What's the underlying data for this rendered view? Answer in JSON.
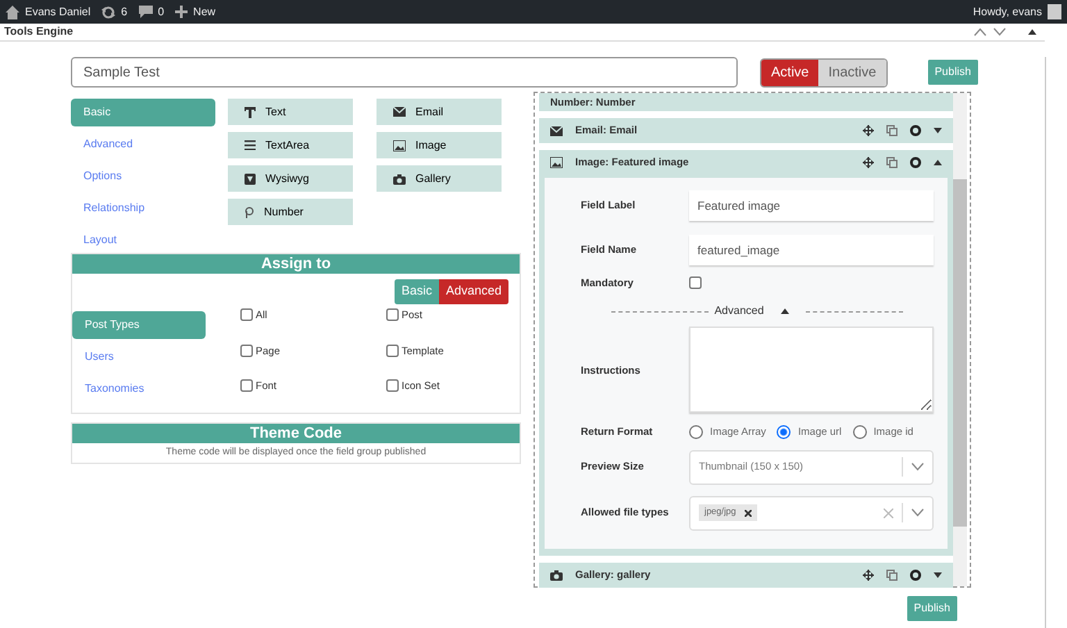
{
  "admin_bar": {
    "items": [
      {
        "label": "Evans Daniel"
      },
      {
        "label": "6"
      },
      {
        "label": "0"
      },
      {
        "label": "New"
      }
    ],
    "greeting": "Howdy, evans"
  },
  "page_title": "Tools Engine",
  "group_title": {
    "value": "Sample Test"
  },
  "status_toggle": [
    {
      "label": "Active",
      "selected": true
    },
    {
      "label": "Inactive",
      "selected": false
    }
  ],
  "top_publish": "Publish",
  "sidebar_tabs": [
    {
      "label": "Basic",
      "selected": true
    },
    {
      "label": "Advanced",
      "selected": false
    },
    {
      "label": "Options",
      "selected": false
    },
    {
      "label": "Relationship",
      "selected": false
    },
    {
      "label": "Layout",
      "selected": false
    }
  ],
  "field_types": [
    {
      "label": "Text"
    },
    {
      "label": "TextArea"
    },
    {
      "label": "Wysiwyg"
    },
    {
      "label": "Number"
    },
    {
      "label": "Email"
    },
    {
      "label": "Image"
    },
    {
      "label": "Gallery"
    }
  ],
  "assign_to": {
    "title": "Assign to",
    "mode_toggle": [
      {
        "label": "Basic",
        "selected": false
      },
      {
        "label": "Advanced",
        "selected": true
      }
    ],
    "tabs": [
      {
        "label": "Post Types",
        "selected": true
      },
      {
        "label": "Users",
        "selected": false
      },
      {
        "label": "Taxonomies",
        "selected": false
      }
    ],
    "options": [
      {
        "label": "All",
        "checked": false
      },
      {
        "label": "Post",
        "checked": false
      },
      {
        "label": "Page",
        "checked": false
      },
      {
        "label": "Template",
        "checked": false
      },
      {
        "label": "Font",
        "checked": false
      },
      {
        "label": "Icon Set",
        "checked": false
      }
    ]
  },
  "theme_code": {
    "title": "Theme Code",
    "message": "Theme code will be displayed once the field group published"
  },
  "fields": [
    {
      "label": "Number: Number",
      "expanded": false
    },
    {
      "label": "Email: Email",
      "expanded": false
    },
    {
      "label": "Image: Featured image",
      "expanded": true
    },
    {
      "label": "Gallery: gallery",
      "expanded": false
    }
  ],
  "field_settings": {
    "field_label": {
      "label": "Field Label",
      "value": "Featured image"
    },
    "field_name": {
      "label": "Field Name",
      "value": "featured_image"
    },
    "mandatory": {
      "label": "Mandatory",
      "checked": false
    },
    "advanced": {
      "label": "Advanced",
      "expanded": true
    },
    "instructions": {
      "label": "Instructions"
    },
    "return_format": {
      "label": "Return Format",
      "options": [
        {
          "label": "Image Array",
          "selected": false
        },
        {
          "label": "Image url",
          "selected": true
        },
        {
          "label": "Image id",
          "selected": false
        }
      ]
    },
    "preview_size": {
      "label": "Preview Size",
      "value": "Thumbnail (150 x 150)"
    },
    "allowed_file_types": {
      "label": "Allowed file types",
      "tags": [
        "jpeg/jpg"
      ]
    }
  },
  "bottom_publish": "Publish"
}
